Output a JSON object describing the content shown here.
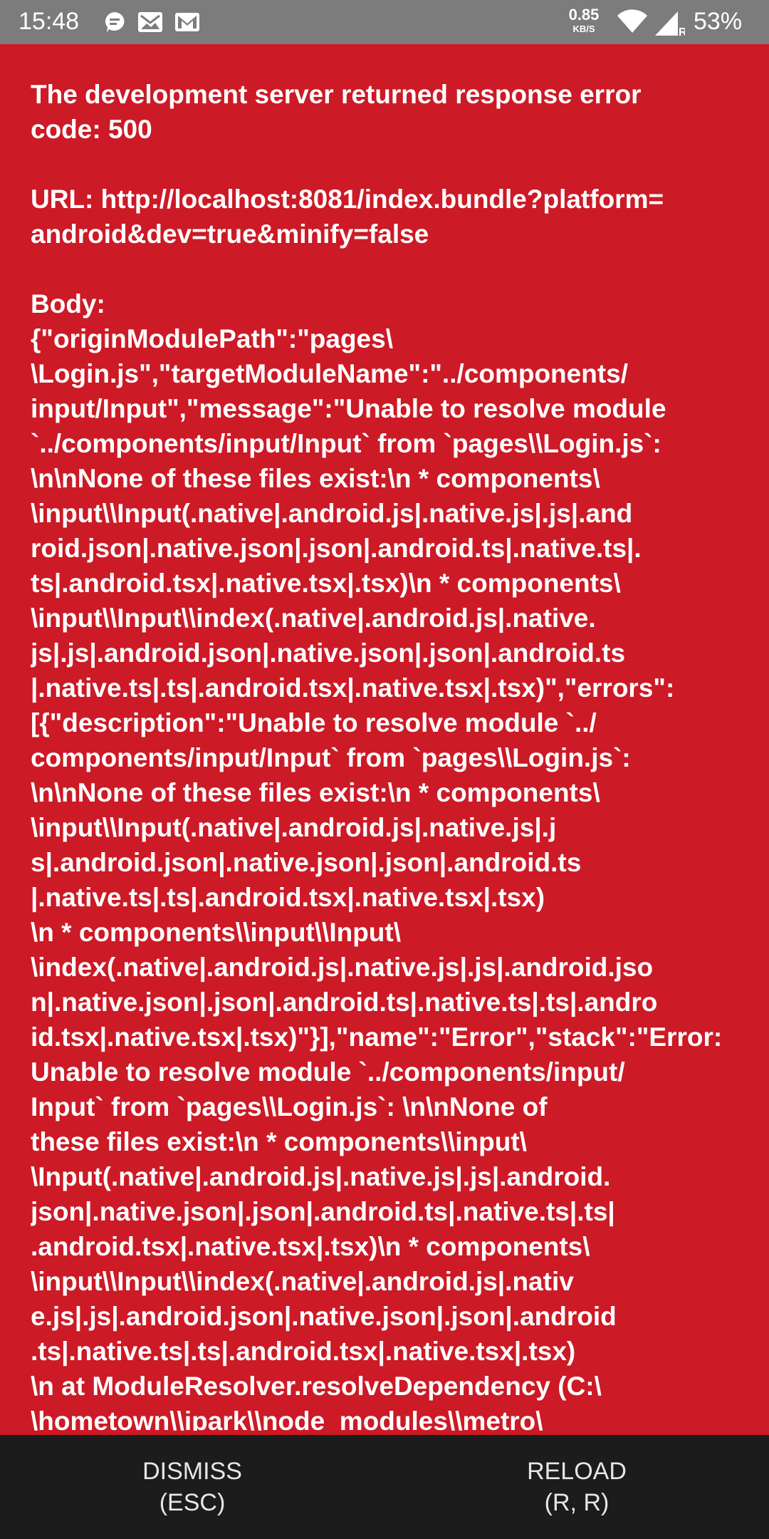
{
  "status_bar": {
    "time": "15:48",
    "notification_icons": [
      "chat-bubble-icon",
      "gallery-mail-icon",
      "gmail-icon"
    ],
    "net_speed_value": "0.85",
    "net_speed_unit": "KB/S",
    "battery": "53%",
    "signal_label": "R",
    "bar_color": "#7c7c7c"
  },
  "error": {
    "background": "#cc1a26",
    "heading_lines": [
      "The development server returned response error",
      "code: 500"
    ],
    "url_lines": [
      "URL: http://localhost:8081/index.bundle?platform=",
      "android&dev=true&minify=false"
    ],
    "body_lines": [
      "Body:",
      "{\"originModulePath\":\"pages\\",
      "\\Login.js\",\"targetModuleName\":\"../components/",
      "input/Input\",\"message\":\"Unable to resolve module",
      "`../components/input/Input` from `pages\\\\Login.js`:",
      "\\n\\nNone of these files exist:\\n  * components\\",
      "\\input\\\\Input(.native|.android.js|.native.js|.js|.and",
      "roid.json|.native.json|.json|.android.ts|.native.ts|.",
      "ts|.android.tsx|.native.tsx|.tsx)\\n  * components\\",
      "\\input\\\\Input\\\\index(.native|.android.js|.native.",
      "js|.js|.android.json|.native.json|.json|.android.ts",
      "|.native.ts|.ts|.android.tsx|.native.tsx|.tsx)\",\"errors\":",
      "[{\"description\":\"Unable to resolve module `../",
      "components/input/Input` from `pages\\\\Login.js`:",
      "\\n\\nNone of these files exist:\\n  * components\\",
      "\\input\\\\Input(.native|.android.js|.native.js|.j",
      "s|.android.json|.native.json|.json|.android.ts",
      "|.native.ts|.ts|.android.tsx|.native.tsx|.tsx)",
      "\\n  * components\\\\input\\\\Input\\",
      "\\index(.native|.android.js|.native.js|.js|.android.jso",
      "n|.native.json|.json|.android.ts|.native.ts|.ts|.andro",
      "id.tsx|.native.tsx|.tsx)\"}],\"name\":\"Error\",\"stack\":\"Error:",
      "Unable to resolve module `../components/input/",
      "Input` from `pages\\\\Login.js`: \\n\\nNone of",
      "these files exist:\\n  * components\\\\input\\",
      "\\Input(.native|.android.js|.native.js|.js|.android.",
      "json|.native.json|.json|.android.ts|.native.ts|.ts|",
      ".android.tsx|.native.tsx|.tsx)\\n  * components\\",
      "\\input\\\\Input\\\\index(.native|.android.js|.nativ",
      "e.js|.js|.android.json|.native.json|.json|.android",
      ".ts|.native.ts|.ts|.android.tsx|.native.tsx|.tsx)",
      "\\n    at ModuleResolver.resolveDependency (C:\\",
      "\\hometown\\\\ipark\\\\node_modules\\\\metro\\"
    ]
  },
  "actions": {
    "dismiss_label": "DISMISS",
    "dismiss_shortcut": "(ESC)",
    "reload_label": "RELOAD",
    "reload_shortcut": "(R, R)"
  }
}
